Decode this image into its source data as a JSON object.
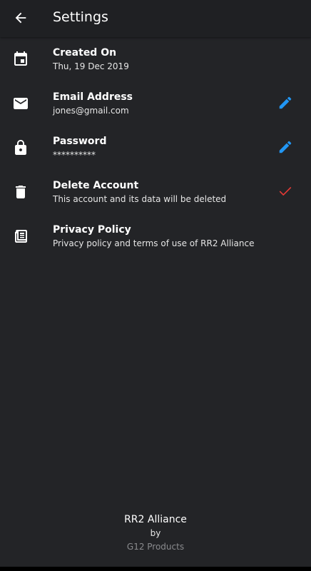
{
  "app_bar": {
    "title": "Settings",
    "back_icon": "arrow-back-icon"
  },
  "colors": {
    "background": "#232427",
    "accent_edit": "#2196f3",
    "accent_confirm": "#e53935"
  },
  "settings": [
    {
      "title": "Created On",
      "subtitle": "Thu, 19 Dec 2019",
      "icon": "calendar-icon"
    },
    {
      "title": "Email Address",
      "subtitle": "jones@gmail.com",
      "icon": "mail-icon",
      "action_icon": "edit-pencil-icon"
    },
    {
      "title": "Password",
      "subtitle": "**********",
      "icon": "lock-icon",
      "action_icon": "edit-pencil-icon"
    },
    {
      "title": "Delete Account",
      "subtitle": "This account and its data will be deleted",
      "icon": "trash-icon",
      "action_icon": "check-icon"
    },
    {
      "title": "Privacy Policy",
      "subtitle": "Privacy policy and terms of use of RR2 Alliance",
      "icon": "document-icon"
    }
  ],
  "footer": {
    "app_name": "RR2 Alliance",
    "by": "by",
    "company": "G12 Products"
  }
}
